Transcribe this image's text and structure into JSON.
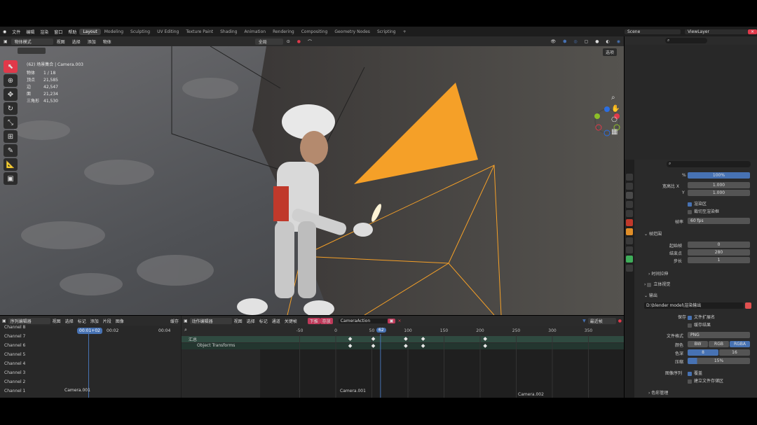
{
  "topbar": {
    "menus": [
      "文件",
      "编辑",
      "渲染",
      "窗口",
      "帮助"
    ],
    "workspaces": [
      "Layout",
      "Modeling",
      "Sculpting",
      "UV Editing",
      "Texture Paint",
      "Shading",
      "Animation",
      "Rendering",
      "Compositing",
      "Geometry Nodes",
      "Scripting"
    ],
    "active_workspace": "Layout",
    "scene": "Scene",
    "viewlayer": "ViewLayer"
  },
  "viewport_header": {
    "mode": "物体模式",
    "menus": [
      "视图",
      "选择",
      "添加",
      "物体"
    ],
    "orientation": "全局",
    "shading_menu": "选项"
  },
  "viewport": {
    "camera_label": "(62) 场景集合 | Camera.003",
    "stats": [
      {
        "k": "物体",
        "v": "1 / 18"
      },
      {
        "k": "顶点",
        "v": "21,585"
      },
      {
        "k": "边",
        "v": "42,547"
      },
      {
        "k": "面",
        "v": "21,234"
      },
      {
        "k": "三角形",
        "v": "41,530"
      }
    ]
  },
  "properties": {
    "percent_label": "%",
    "percent_value": "100%",
    "aspect_x_label": "宽高比 X",
    "aspect_x": "1.000",
    "aspect_y_label": "Y",
    "aspect_y": "1.000",
    "render_region": "渲染区",
    "crop_region": "裁切至渲染框",
    "frame_rate_label": "帧率",
    "frame_rate": "60 fps",
    "frame_range_title": "帧范围",
    "start_label": "起始帧",
    "start": "0",
    "end_label": "结束点",
    "end": "280",
    "step_label": "步长",
    "step": "1",
    "time_stretch": "时间拉伸",
    "stereoscopy": "立体视觉",
    "output_title": "输出",
    "output_path": "D:\\blender model\\渲染输出\\Daigo\\Daigo_hershin",
    "save_label": "保存",
    "file_ext": "文件扩展名",
    "cache": "缓存结果",
    "file_format_label": "文件格式",
    "file_format": "PNG",
    "color_label": "颜色",
    "color_modes": [
      "BW",
      "RGB",
      "RGBA"
    ],
    "color_depth_label": "色深",
    "depth_values": [
      "8",
      "16"
    ],
    "compression_label": "压缩",
    "compression": "15%",
    "image_seq_label": "图像序列",
    "overwrite": "覆盖",
    "placeholder": "建立文件存储区",
    "color_management": "色彩管理"
  },
  "sequencer": {
    "editor": "序列编辑器",
    "menus": [
      "视图",
      "选择",
      "标记",
      "添加",
      "片段",
      "图像"
    ],
    "cache": "缓存",
    "current_time": "00:01+02",
    "time_marks": [
      "00:02",
      "00:04"
    ],
    "channels": [
      "Channel 8",
      "Channel 7",
      "Channel 6",
      "Channel 5",
      "Channel 4",
      "Channel 3",
      "Channel 2",
      "Channel 1"
    ],
    "strip": "Camera.001"
  },
  "dopesheet": {
    "editor": "动作编辑器",
    "menus": [
      "视图",
      "选择",
      "标记",
      "通道",
      "关键帧"
    ],
    "push_down": "下推",
    "stash": "存放",
    "action": "CameraAction",
    "filter": "最近帧",
    "summary": "汇总",
    "channel": "Object Transforms",
    "current_frame": "62",
    "ticks": [
      "-50",
      "0",
      "50",
      "100",
      "150",
      "200",
      "250",
      "300",
      "350"
    ],
    "markers": [
      "Camera.001",
      "Camera.002"
    ]
  },
  "colors": {
    "accent": "#4772b3",
    "active_tool": "#e0394a",
    "frame": "#4772b3",
    "camera_orange": "#f5a028"
  }
}
